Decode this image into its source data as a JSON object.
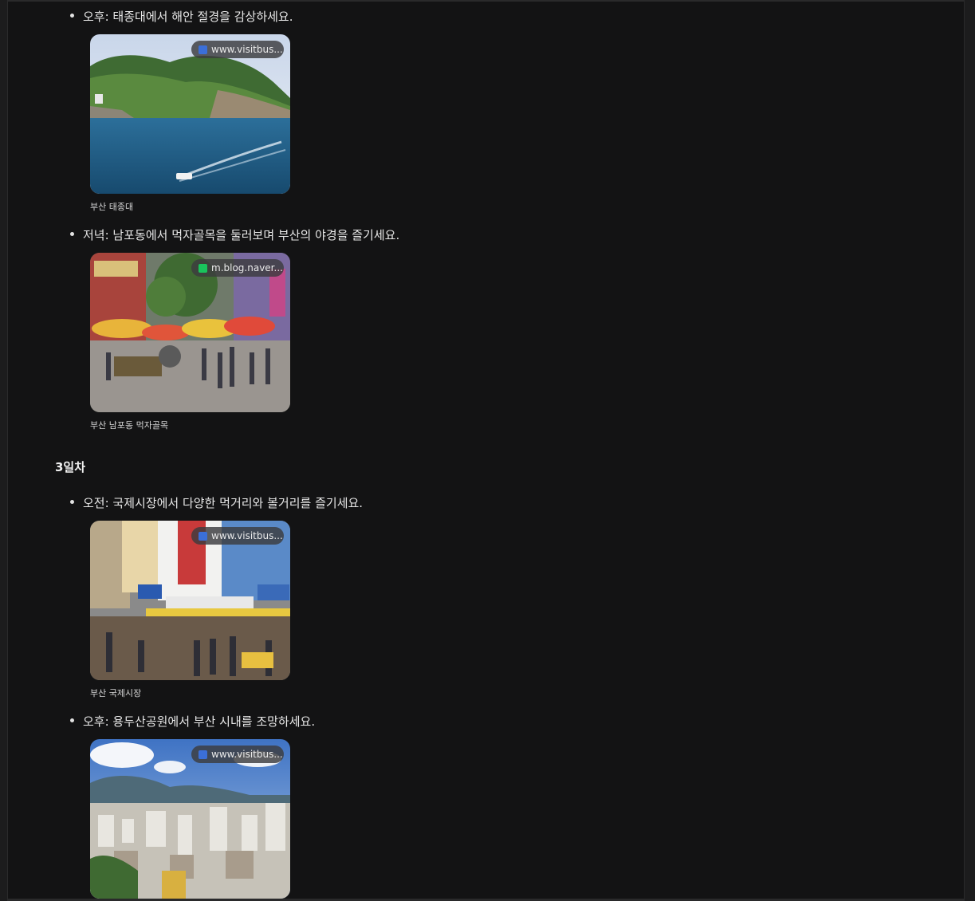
{
  "items": [
    {
      "bullet": "오후: 태종대에서 해안 절경을 감상하세요.",
      "source": "www.visitbus...",
      "caption": "부산 태종대"
    },
    {
      "bullet": "저녁: 남포동에서 먹자골목을 둘러보며 부산의 야경을 즐기세요.",
      "source": "m.blog.naver....",
      "caption": "부산 남포동 먹자골목"
    },
    {
      "bullet": "오전: 국제시장에서 다양한 먹거리와 볼거리를 즐기세요.",
      "source": "www.visitbus...",
      "caption": "부산 국제시장"
    },
    {
      "bullet": "오후: 용두산공원에서 부산 시내를 조망하세요.",
      "source": "www.visitbus...",
      "caption": ""
    }
  ],
  "day3": {
    "heading": "3일차"
  },
  "colors": {
    "background": "#131314",
    "visitbusan_favicon": "#3b6fd8",
    "naver_favicon": "#19c45c"
  },
  "icons": {
    "visitbusan": "visitbusan-favicon-icon",
    "naver": "naver-blog-favicon-icon"
  }
}
